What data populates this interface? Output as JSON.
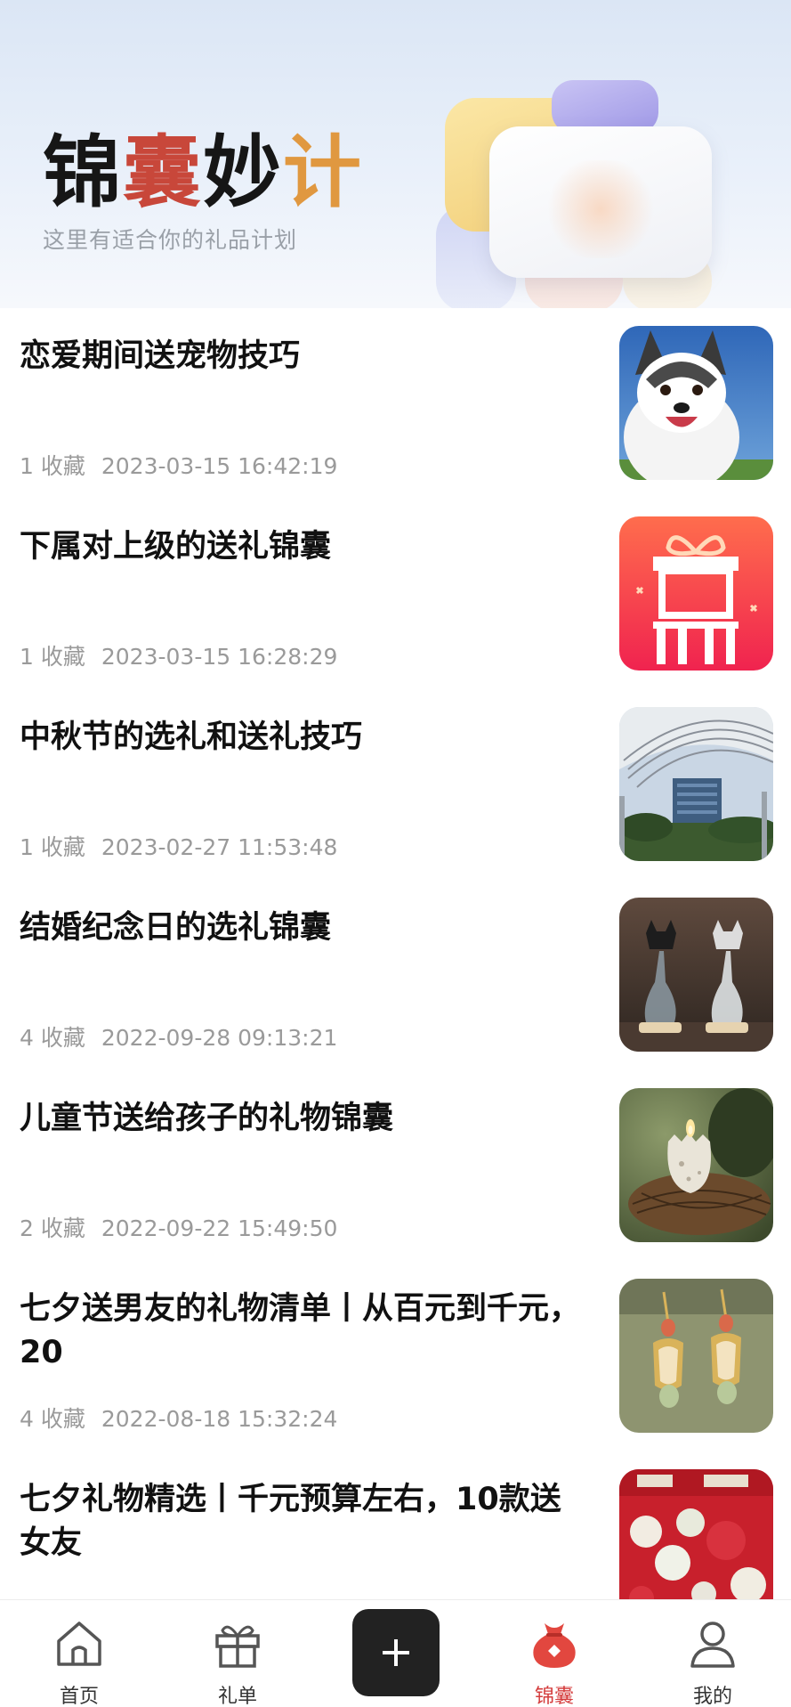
{
  "banner": {
    "title_chars": [
      "锦",
      "囊",
      "妙",
      "计"
    ],
    "subtitle": "这里有适合你的礼品计划"
  },
  "colors": {
    "accent": "#d43c3c",
    "title_red": "#c8473a",
    "title_orange": "#e09840",
    "meta_gray": "#9a9a9a"
  },
  "items": [
    {
      "title": "恋爱期间送宠物技巧",
      "favorites": "1 收藏",
      "time": "2023-03-15 16:42:19",
      "image": "husky-puppy"
    },
    {
      "title": "下属对上级的送礼锦囊",
      "favorites": "1 收藏",
      "time": "2023-03-15 16:28:29",
      "image": "red-gift-box-icon"
    },
    {
      "title": "中秋节的选礼和送礼技巧",
      "favorites": "1 收藏",
      "time": "2023-02-27 11:53:48",
      "image": "building-canopy"
    },
    {
      "title": "结婚纪念日的选礼锦囊",
      "favorites": "4 收藏",
      "time": "2022-09-28 09:13:21",
      "image": "cat-hourglass"
    },
    {
      "title": "儿童节送给孩子的礼物锦囊",
      "favorites": "2 收藏",
      "time": "2022-09-22 15:49:50",
      "image": "egg-candle-nest"
    },
    {
      "title": "七夕送男友的礼物清单丨从百元到千元，20",
      "favorites": "4 收藏",
      "time": "2022-08-18 15:32:24",
      "image": "gold-earrings"
    },
    {
      "title": "七夕礼物精选丨千元预算左右，10款送女友",
      "favorites": "",
      "time": "",
      "image": "red-gift-packaging"
    }
  ],
  "tabbar": {
    "home_label": "首页",
    "gift_label": "礼单",
    "add_icon": "plus-icon",
    "jinnang_label": "锦囊",
    "me_label": "我的",
    "active": "jinnang"
  }
}
